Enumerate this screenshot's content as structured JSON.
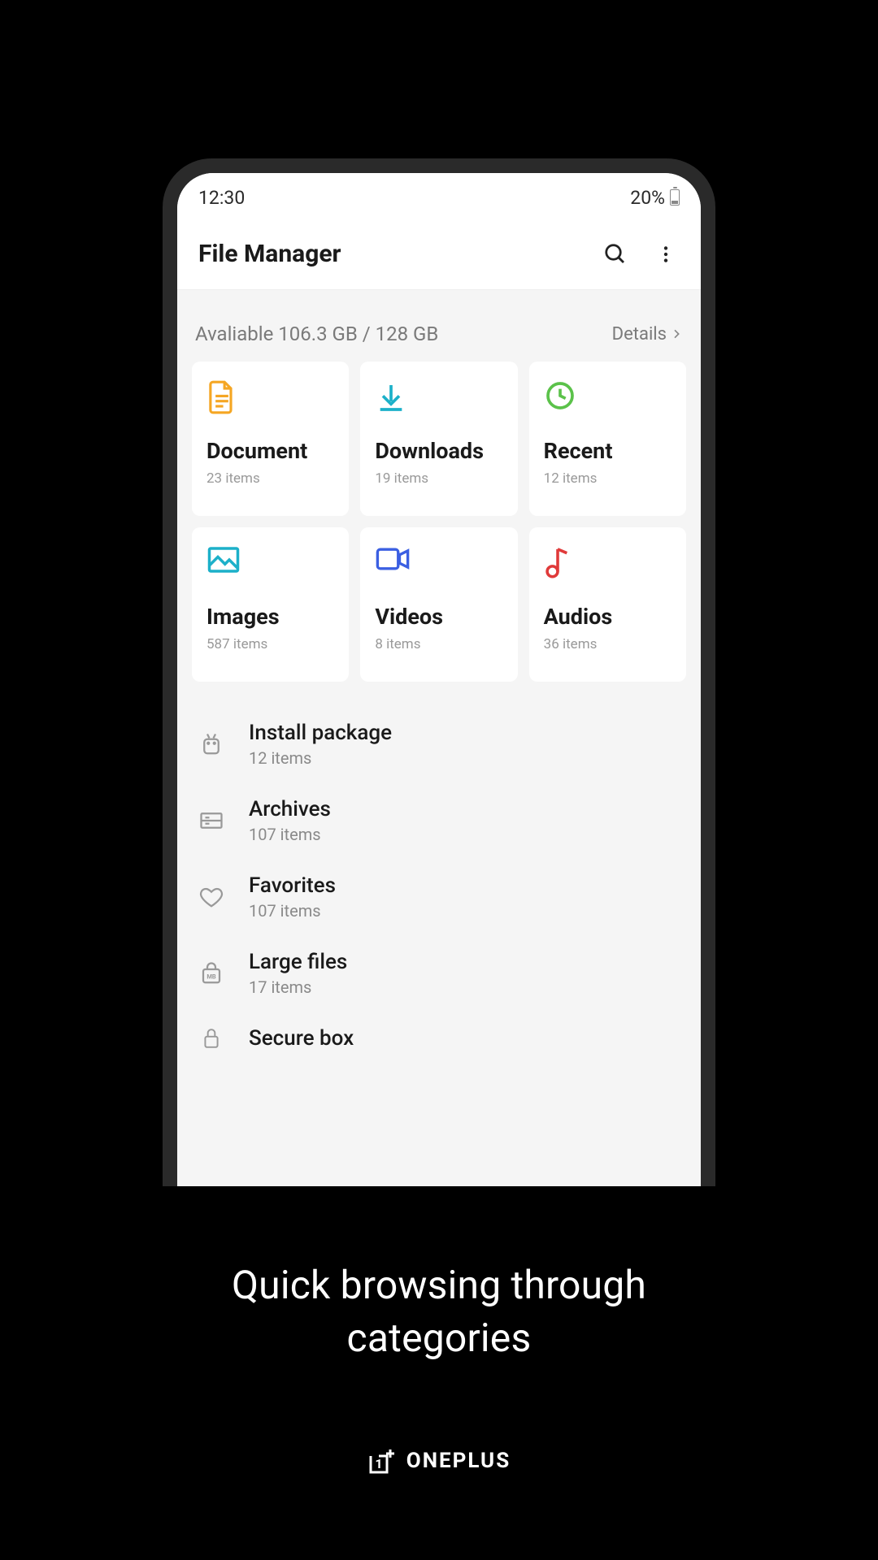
{
  "statusbar": {
    "time": "12:30",
    "battery": "20%"
  },
  "appbar": {
    "title": "File Manager"
  },
  "storage": {
    "text": "Avaliable 106.3 GB / 128 GB",
    "details_label": "Details"
  },
  "categories": [
    {
      "key": "document",
      "label": "Document",
      "sub": "23 items",
      "color": "#f5a623"
    },
    {
      "key": "downloads",
      "label": "Downloads",
      "sub": "19 items",
      "color": "#1cb0c9"
    },
    {
      "key": "recent",
      "label": "Recent",
      "sub": "12 items",
      "color": "#5bc24a"
    },
    {
      "key": "images",
      "label": "Images",
      "sub": "587 items",
      "color": "#1cb0c9"
    },
    {
      "key": "videos",
      "label": "Videos",
      "sub": "8 items",
      "color": "#3b5fe2"
    },
    {
      "key": "audios",
      "label": "Audios",
      "sub": "36 items",
      "color": "#e03a3a"
    }
  ],
  "list": [
    {
      "key": "install-package",
      "label": "Install package",
      "sub": "12 items"
    },
    {
      "key": "archives",
      "label": "Archives",
      "sub": "107 items"
    },
    {
      "key": "favorites",
      "label": "Favorites",
      "sub": "107 items"
    },
    {
      "key": "large-files",
      "label": "Large files",
      "sub": "17 items"
    },
    {
      "key": "secure-box",
      "label": "Secure box",
      "sub": ""
    }
  ],
  "caption": "Quick browsing through categories",
  "brand": "ONEPLUS"
}
